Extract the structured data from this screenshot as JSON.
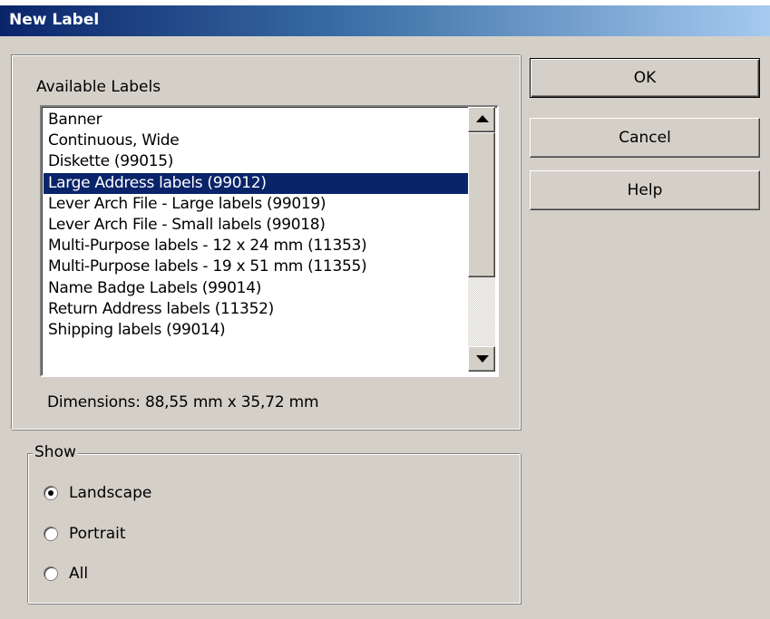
{
  "window": {
    "title": "New Label"
  },
  "labels_group": {
    "caption": "Available Labels",
    "items": [
      "Banner",
      "Continuous, Wide",
      "Diskette (99015)",
      "Large Address labels (99012)",
      "Lever Arch File - Large labels (99019)",
      "Lever Arch File - Small labels (99018)",
      "Multi-Purpose labels - 12 x 24 mm (11353)",
      "Multi-Purpose labels - 19 x 51 mm (11355)",
      "Name Badge Labels (99014)",
      "Return Address labels (11352)",
      "Shipping labels (99014)"
    ],
    "selected_item": "Large Address labels (99012)",
    "dimensions_text": "Dimensions: 88,55 mm x 35,72 mm"
  },
  "show_group": {
    "caption": "Show",
    "options": [
      {
        "label": "Landscape",
        "checked": true
      },
      {
        "label": "Portrait",
        "checked": false
      },
      {
        "label": "All",
        "checked": false
      }
    ]
  },
  "buttons": {
    "ok": "OK",
    "cancel": "Cancel",
    "help": "Help"
  },
  "colors": {
    "dialog_face": "#d4d0c8",
    "selection": "#0a246a",
    "titlebar_start": "#0a246a",
    "titlebar_end": "#a6caf0"
  },
  "icons": {
    "scroll_up": "scroll-up-arrow-icon",
    "scroll_down": "scroll-down-arrow-icon"
  }
}
